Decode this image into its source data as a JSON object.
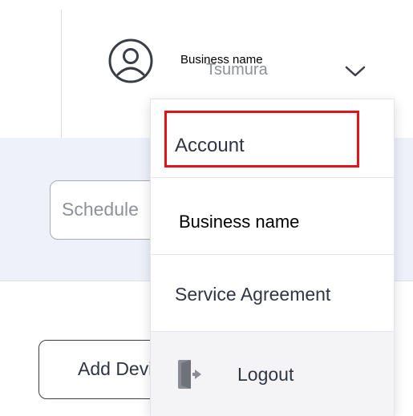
{
  "header": {
    "business_label": "Business  name",
    "user_name": "Tsumura"
  },
  "page": {
    "schedule_input_value": "Schedule",
    "add_button_label": "Add Device"
  },
  "menu": {
    "items": [
      {
        "label": "Account",
        "highlighted": true
      },
      {
        "label": "Business name"
      },
      {
        "label": "Service Agreement"
      },
      {
        "label": "Logout",
        "icon": "logout-icon"
      }
    ]
  },
  "colors": {
    "highlight": "#e0141b",
    "band_bg": "#eef1fa",
    "text": "#2f3542",
    "muted": "#8d9198",
    "icon": "#8a8d93"
  },
  "icons": [
    "user-avatar-icon",
    "chevron-down-icon",
    "logout-icon"
  ]
}
